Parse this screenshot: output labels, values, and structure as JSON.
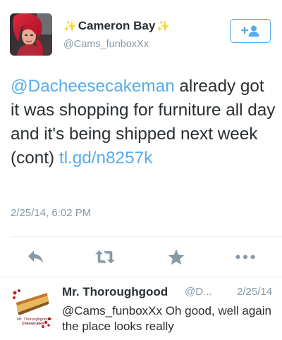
{
  "tweet": {
    "sparkle_left": "✨",
    "display_name": "Cameron Bay",
    "sparkle_right": "✨",
    "handle": "@Cams_funboxXx",
    "follow_icon": "add-user-icon",
    "text": {
      "mention": "@Dacheesecakeman",
      "body": " already got it was shopping for furniture all day and it's being shipped next week (cont) ",
      "link": "tl.gd/n8257k"
    },
    "timestamp": "2/25/14, 6:02 PM",
    "actions": [
      {
        "icon": "reply-icon"
      },
      {
        "icon": "retweet-icon"
      },
      {
        "icon": "favorite-star-icon"
      },
      {
        "icon": "more-icon"
      }
    ]
  },
  "reply": {
    "display_name": "Mr. Thoroughgood",
    "handle": "@D...",
    "date": "2/25/14",
    "text": "@Cams_funboxXx Oh good, well again the place looks really",
    "avatar_text_1": "Mr. Thoroughgood's",
    "avatar_text_2": "Cheesecakes"
  },
  "colors": {
    "accent": "#55acee",
    "secondary_text": "#8899a6",
    "primary_text": "#292f33",
    "action_icon": "#8899a6"
  }
}
